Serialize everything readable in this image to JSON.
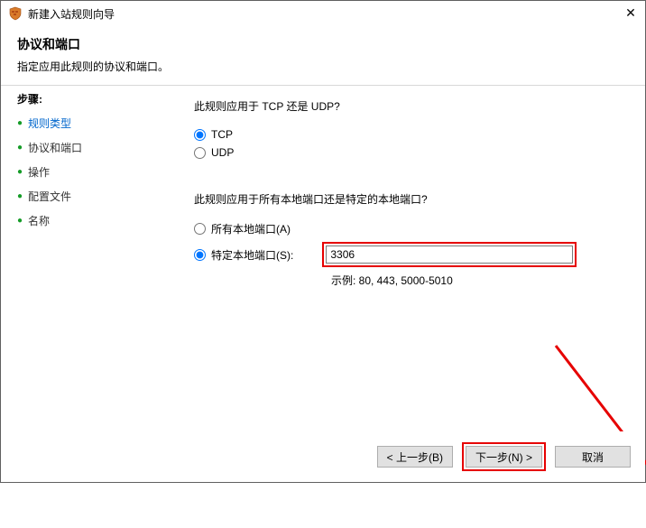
{
  "window": {
    "title": "新建入站规则向导",
    "close_glyph": "✕"
  },
  "header": {
    "title": "协议和端口",
    "desc": "指定应用此规则的协议和端口。"
  },
  "steps": {
    "label": "步骤:",
    "items": [
      {
        "label": "规则类型",
        "active": true
      },
      {
        "label": "协议和端口",
        "active": false
      },
      {
        "label": "操作",
        "active": false
      },
      {
        "label": "配置文件",
        "active": false
      },
      {
        "label": "名称",
        "active": false
      }
    ]
  },
  "main": {
    "protocol_question": "此规则应用于 TCP 还是 UDP?",
    "tcp_label": "TCP",
    "udp_label": "UDP",
    "port_question": "此规则应用于所有本地端口还是特定的本地端口?",
    "all_ports_label": "所有本地端口(A)",
    "specific_ports_label": "特定本地端口(S):",
    "port_value": "3306",
    "example_label": "示例: 80, 443, 5000-5010"
  },
  "buttons": {
    "back": "< 上一步(B)",
    "next": "下一步(N) >",
    "cancel": "取消"
  }
}
